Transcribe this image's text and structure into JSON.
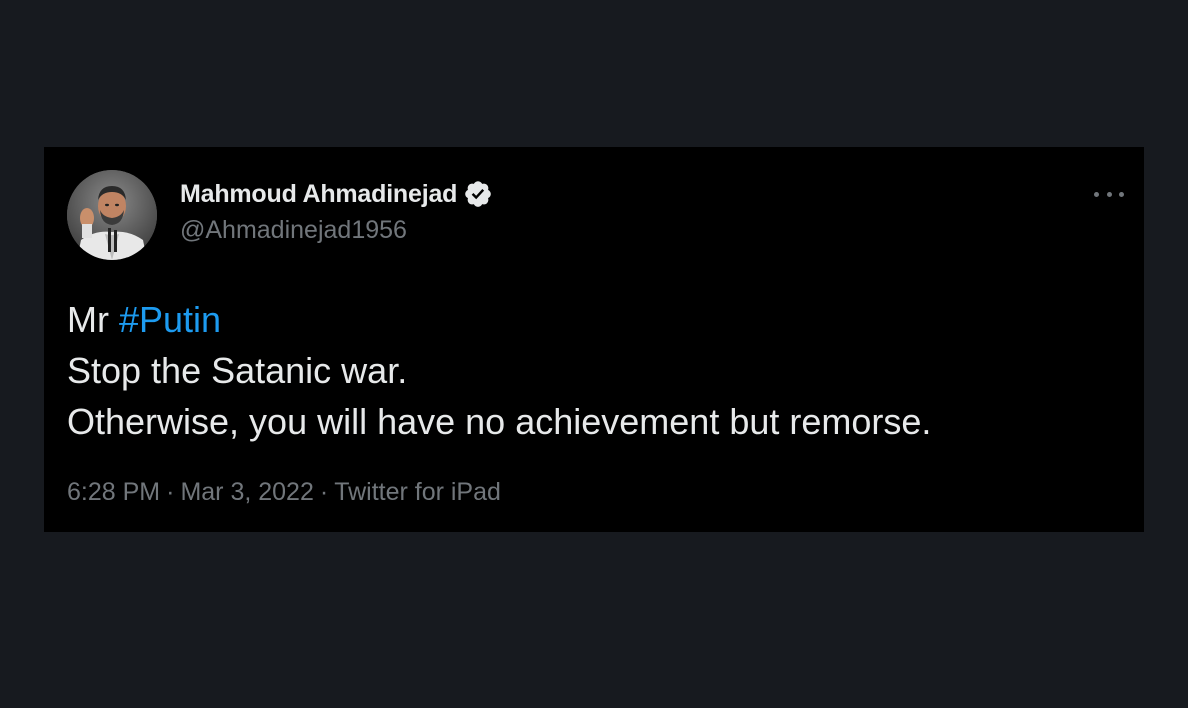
{
  "author": {
    "display_name": "Mahmoud Ahmadinejad",
    "handle": "@Ahmadinejad1956",
    "verified": true
  },
  "tweet": {
    "line1_prefix": "Mr",
    "hashtag": "#Putin",
    "line2": "Stop the Satanic war.",
    "line3": "Otherwise, you will have no achievement but remorse."
  },
  "meta": {
    "time": "6:28 PM",
    "separator": "·",
    "date": "Mar 3, 2022",
    "source": "Twitter for iPad"
  },
  "icons": {
    "verified": "verified-badge-icon",
    "more": "more-horizontal-icon",
    "avatar": "avatar-photo"
  },
  "colors": {
    "page_background": "#171a1f",
    "card_background": "#000000",
    "primary_text": "#e7e9ea",
    "secondary_text": "#71767b",
    "hashtag": "#1d9bf0"
  }
}
